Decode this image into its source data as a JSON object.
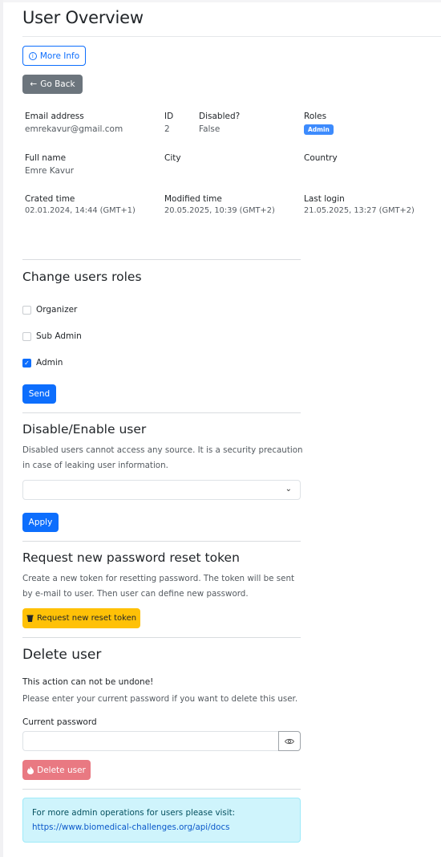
{
  "page": {
    "title": "User Overview",
    "more_info_label": "More Info",
    "go_back_label": "Go Back"
  },
  "details": {
    "email_label": "Email address",
    "email_value": "emrekavur@gmail.com",
    "id_label": "ID",
    "id_value": "2",
    "disabled_label": "Disabled?",
    "disabled_value": "False",
    "roles_label": "Roles",
    "roles_badge": "Admin",
    "fullname_label": "Full name",
    "fullname_value": "Emre Kavur",
    "city_label": "City",
    "country_label": "Country",
    "created_label": "Crated time",
    "created_value": "02.01.2024, 14:44 (GMT+1)",
    "modified_label": "Modified time",
    "modified_value": "20.05.2025, 10:39 (GMT+2)",
    "lastlogin_label": "Last login",
    "lastlogin_value": "21.05.2025, 13:27 (GMT+2)"
  },
  "roles_section": {
    "heading": "Change users roles",
    "options": [
      {
        "label": "Organizer",
        "checked": false
      },
      {
        "label": "Sub Admin",
        "checked": false
      },
      {
        "label": "Admin",
        "checked": true
      }
    ],
    "send_label": "Send"
  },
  "disable_section": {
    "heading": "Disable/Enable user",
    "description": "Disabled users cannot access any source. It is a security precaution in case of leaking user information.",
    "select_value": "",
    "apply_label": "Apply"
  },
  "reset_section": {
    "heading": "Request new password reset token",
    "description": "Create a new token for resetting password. The token will be sent by e-mail to user. Then user can define new password.",
    "button_label": "Request new reset token"
  },
  "delete_section": {
    "heading": "Delete user",
    "warning": "This action can not be undone!",
    "instruction": "Please enter your current password if you want to delete this user.",
    "password_label": "Current password",
    "password_value": "",
    "button_label": "Delete user"
  },
  "info_alert": {
    "text": "For more admin operations for users please visit:",
    "link": "https://www.biomedical-challenges.org/api/docs"
  },
  "colors": {
    "primary": "#0d6efd",
    "secondary": "#6c757d",
    "warning": "#ffc107",
    "danger": "#e97982",
    "info_bg": "#cff4fc"
  },
  "icons": {
    "more_info": "info-circle-icon",
    "go_back": "arrow-left-icon",
    "select": "chevron-down-icon",
    "reset": "bucket-icon",
    "password_toggle": "eye-icon",
    "delete": "fire-icon"
  }
}
